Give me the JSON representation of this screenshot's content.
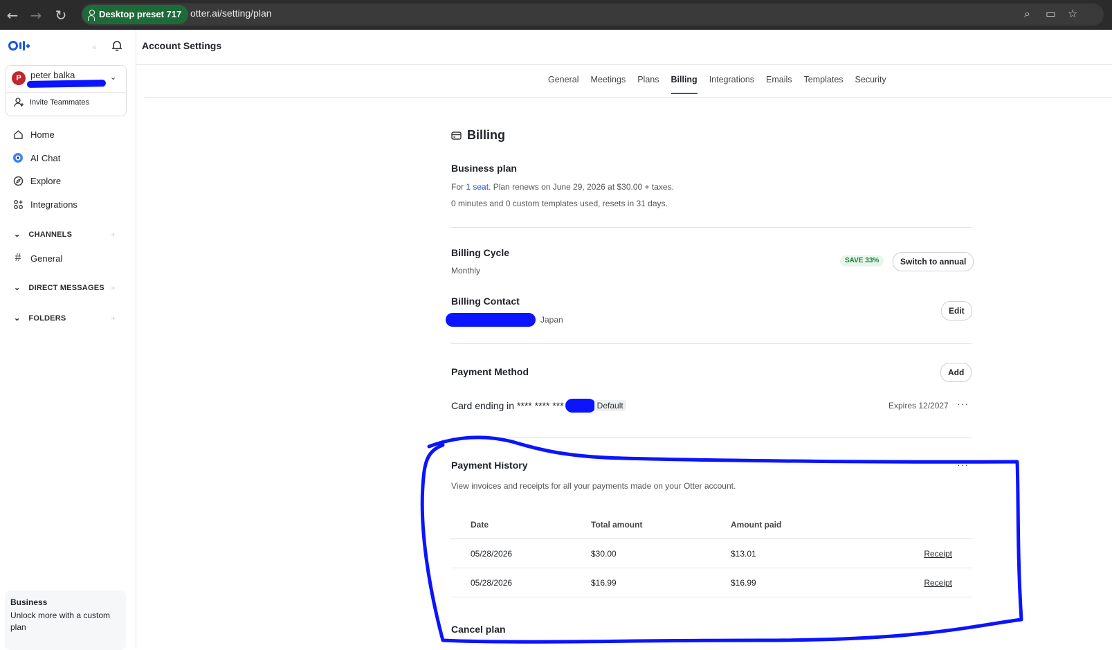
{
  "browser": {
    "preset_label": "Desktop preset 717",
    "url": "otter.ai/setting/plan"
  },
  "sidebar": {
    "user_initial": "P",
    "user_name": "peter balka",
    "invite_label": "Invite Teammates",
    "nav": [
      {
        "label": "Home",
        "icon": "home-icon"
      },
      {
        "label": "AI Chat",
        "icon": "ai-chat-icon"
      },
      {
        "label": "Explore",
        "icon": "compass-icon"
      },
      {
        "label": "Integrations",
        "icon": "apps-icon"
      }
    ],
    "channels_label": "CHANNELS",
    "channel_general": "General",
    "direct_messages_label": "DIRECT MESSAGES",
    "folders_label": "FOLDERS",
    "promo_title": "Business",
    "promo_text": "Unlock more with a custom plan"
  },
  "header": {
    "title": "Account Settings"
  },
  "tabs": [
    "General",
    "Meetings",
    "Plans",
    "Billing",
    "Integrations",
    "Emails",
    "Templates",
    "Security"
  ],
  "active_tab": "Billing",
  "billing": {
    "title": "Billing",
    "plan_name": "Business plan",
    "plan_prefix": "For ",
    "plan_seat_link": "1 seat",
    "plan_suffix": ". Plan renews on June 29, 2026 at $30.00 + taxes.",
    "usage": "0 minutes and 0 custom templates used, resets in 31 days.",
    "cycle_title": "Billing Cycle",
    "cycle_value": "Monthly",
    "save_badge": "SAVE 33%",
    "switch_button": "Switch to annual",
    "contact_title": "Billing Contact",
    "contact_country": "Japan",
    "edit_button": "Edit",
    "payment_title": "Payment Method",
    "add_button": "Add",
    "card_label": "Card ending in **** **** ***",
    "default_tag": "Default",
    "expires": "Expires 12/2027",
    "history_title": "Payment History",
    "history_desc": "View invoices and receipts for all your payments made on your Otter account.",
    "history_columns": [
      "Date",
      "Total amount",
      "Amount paid"
    ],
    "history_rows": [
      {
        "date": "05/28/2026",
        "total": "$30.00",
        "paid": "$13.01",
        "action": "Receipt"
      },
      {
        "date": "05/28/2026",
        "total": "$16.99",
        "paid": "$16.99",
        "action": "Receipt"
      }
    ],
    "cancel_title": "Cancel plan"
  },
  "colors": {
    "accent": "#1a56db",
    "annotation": "#0a14ff",
    "avatar": "#c0262d",
    "save_badge_bg": "#e6f6ea"
  }
}
